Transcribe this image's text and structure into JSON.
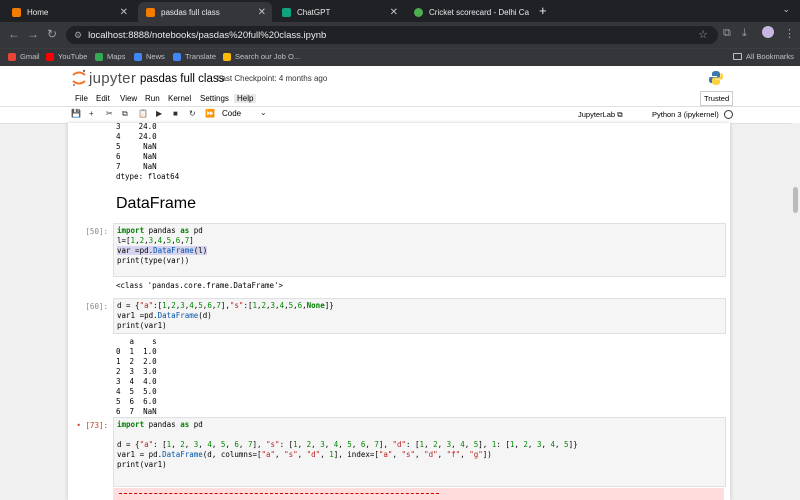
{
  "browser": {
    "tabs": [
      {
        "label": "Home",
        "color": "#f57c00",
        "active": false
      },
      {
        "label": "pasdas full class",
        "color": "#f57c00",
        "active": true
      },
      {
        "label": "ChatGPT",
        "color": "#10a37f",
        "active": false
      },
      {
        "label": "Cricket scorecard - Delhi Ca...",
        "color": "#4caf50",
        "active": false
      }
    ],
    "url": "localhost:8888/notebooks/pasdas%20full%20class.ipynb",
    "bookmarks": [
      "Gmail",
      "YouTube",
      "Maps",
      "News",
      "Translate",
      "Search our Job O..."
    ],
    "all_bookmarks": "All Bookmarks"
  },
  "jupyter": {
    "logo": "jupyter",
    "notebook_title": "pasdas full class",
    "checkpoint": "Last Checkpoint: 4 months ago",
    "menus": [
      "File",
      "Edit",
      "View",
      "Run",
      "Kernel",
      "Settings",
      "Help"
    ],
    "trusted": "Trusted",
    "cell_type": "Code",
    "jupyterlab": "JupyterLab",
    "kernel": "Python 3 (ipykernel)"
  },
  "cells": {
    "out_series": "3    24.0\n4    24.0\n5     NaN\n6     NaN\n7     NaN\ndtype: float64",
    "heading": "DataFrame",
    "c50": {
      "prompt": "[50]:",
      "code": [
        {
          "t": "import",
          "c": "kw"
        },
        {
          "t": " pandas "
        },
        {
          "t": "as",
          "c": "kw"
        },
        {
          "t": " pd\nl=["
        },
        {
          "t": "1",
          "c": "num"
        },
        {
          "t": ","
        },
        {
          "t": "2",
          "c": "num"
        },
        {
          "t": ","
        },
        {
          "t": "3",
          "c": "num"
        },
        {
          "t": ","
        },
        {
          "t": "4",
          "c": "num"
        },
        {
          "t": ","
        },
        {
          "t": "5",
          "c": "num"
        },
        {
          "t": ","
        },
        {
          "t": "6",
          "c": "num"
        },
        {
          "t": ","
        },
        {
          "t": "7",
          "c": "num"
        },
        {
          "t": "]\n"
        },
        {
          "t": "var =pd.",
          "c": "hl"
        },
        {
          "t": "DataFrame",
          "c": "fn hl"
        },
        {
          "t": "(",
          "c": "hl"
        },
        {
          "t": "l",
          "c": "hl"
        },
        {
          "t": ")",
          "c": "hl"
        },
        {
          "t": "\nprint(type(var))"
        }
      ],
      "output": "<class 'pandas.core.frame.DataFrame'>"
    },
    "c60": {
      "prompt": "[60]:",
      "code": [
        {
          "t": "d = {"
        },
        {
          "t": "\"a\"",
          "c": "str"
        },
        {
          "t": ":["
        },
        {
          "t": "1",
          "c": "num"
        },
        {
          "t": ","
        },
        {
          "t": "2",
          "c": "num"
        },
        {
          "t": ","
        },
        {
          "t": "3",
          "c": "num"
        },
        {
          "t": ","
        },
        {
          "t": "4",
          "c": "num"
        },
        {
          "t": ","
        },
        {
          "t": "5",
          "c": "num"
        },
        {
          "t": ","
        },
        {
          "t": "6",
          "c": "num"
        },
        {
          "t": ","
        },
        {
          "t": "7",
          "c": "num"
        },
        {
          "t": "],"
        },
        {
          "t": "\"s\"",
          "c": "str"
        },
        {
          "t": ":["
        },
        {
          "t": "1",
          "c": "num"
        },
        {
          "t": ","
        },
        {
          "t": "2",
          "c": "num"
        },
        {
          "t": ","
        },
        {
          "t": "3",
          "c": "num"
        },
        {
          "t": ","
        },
        {
          "t": "4",
          "c": "num"
        },
        {
          "t": ","
        },
        {
          "t": "5",
          "c": "num"
        },
        {
          "t": ","
        },
        {
          "t": "6",
          "c": "num"
        },
        {
          "t": ","
        },
        {
          "t": "None",
          "c": "kw"
        },
        {
          "t": "]}\nvar1 =pd."
        },
        {
          "t": "DataFrame",
          "c": "fn"
        },
        {
          "t": "(d)\nprint(var1)"
        }
      ],
      "output": "   a    s\n0  1  1.0\n1  2  2.0\n2  3  3.0\n3  4  4.0\n4  5  5.0\n5  6  6.0\n6  7  NaN"
    },
    "c73": {
      "prompt": "[73]:",
      "code": [
        {
          "t": "import",
          "c": "kw"
        },
        {
          "t": " pandas "
        },
        {
          "t": "as",
          "c": "kw"
        },
        {
          "t": " pd\n\nd = {"
        },
        {
          "t": "\"a\"",
          "c": "str"
        },
        {
          "t": ": ["
        },
        {
          "t": "1",
          "c": "num"
        },
        {
          "t": ", "
        },
        {
          "t": "2",
          "c": "num"
        },
        {
          "t": ", "
        },
        {
          "t": "3",
          "c": "num"
        },
        {
          "t": ", "
        },
        {
          "t": "4",
          "c": "num"
        },
        {
          "t": ", "
        },
        {
          "t": "5",
          "c": "num"
        },
        {
          "t": ", "
        },
        {
          "t": "6",
          "c": "num"
        },
        {
          "t": ", "
        },
        {
          "t": "7",
          "c": "num"
        },
        {
          "t": "], "
        },
        {
          "t": "\"s\"",
          "c": "str"
        },
        {
          "t": ": ["
        },
        {
          "t": "1",
          "c": "num"
        },
        {
          "t": ", "
        },
        {
          "t": "2",
          "c": "num"
        },
        {
          "t": ", "
        },
        {
          "t": "3",
          "c": "num"
        },
        {
          "t": ", "
        },
        {
          "t": "4",
          "c": "num"
        },
        {
          "t": ", "
        },
        {
          "t": "5",
          "c": "num"
        },
        {
          "t": ", "
        },
        {
          "t": "6",
          "c": "num"
        },
        {
          "t": ", "
        },
        {
          "t": "7",
          "c": "num"
        },
        {
          "t": "], "
        },
        {
          "t": "\"d\"",
          "c": "str"
        },
        {
          "t": ": ["
        },
        {
          "t": "1",
          "c": "num"
        },
        {
          "t": ", "
        },
        {
          "t": "2",
          "c": "num"
        },
        {
          "t": ", "
        },
        {
          "t": "3",
          "c": "num"
        },
        {
          "t": ", "
        },
        {
          "t": "4",
          "c": "num"
        },
        {
          "t": ", "
        },
        {
          "t": "5",
          "c": "num"
        },
        {
          "t": "], "
        },
        {
          "t": "1",
          "c": "num"
        },
        {
          "t": ": ["
        },
        {
          "t": "1",
          "c": "num"
        },
        {
          "t": ", "
        },
        {
          "t": "2",
          "c": "num"
        },
        {
          "t": ", "
        },
        {
          "t": "3",
          "c": "num"
        },
        {
          "t": ", "
        },
        {
          "t": "4",
          "c": "num"
        },
        {
          "t": ", "
        },
        {
          "t": "5",
          "c": "num"
        },
        {
          "t": "]}\nvar1 = pd."
        },
        {
          "t": "DataFrame",
          "c": "fn"
        },
        {
          "t": "(d, columns=["
        },
        {
          "t": "\"a\"",
          "c": "str"
        },
        {
          "t": ", "
        },
        {
          "t": "\"s\"",
          "c": "str"
        },
        {
          "t": ", "
        },
        {
          "t": "\"d\"",
          "c": "str"
        },
        {
          "t": ", "
        },
        {
          "t": "1",
          "c": "num"
        },
        {
          "t": "], index=["
        },
        {
          "t": "\"a\"",
          "c": "str"
        },
        {
          "t": ", "
        },
        {
          "t": "\"s\"",
          "c": "str"
        },
        {
          "t": ", "
        },
        {
          "t": "\"d\"",
          "c": "str"
        },
        {
          "t": ", "
        },
        {
          "t": "\"f\"",
          "c": "str"
        },
        {
          "t": ", "
        },
        {
          "t": "\"g\"",
          "c": "str"
        },
        {
          "t": "])\nprint(var1)"
        }
      ]
    }
  }
}
